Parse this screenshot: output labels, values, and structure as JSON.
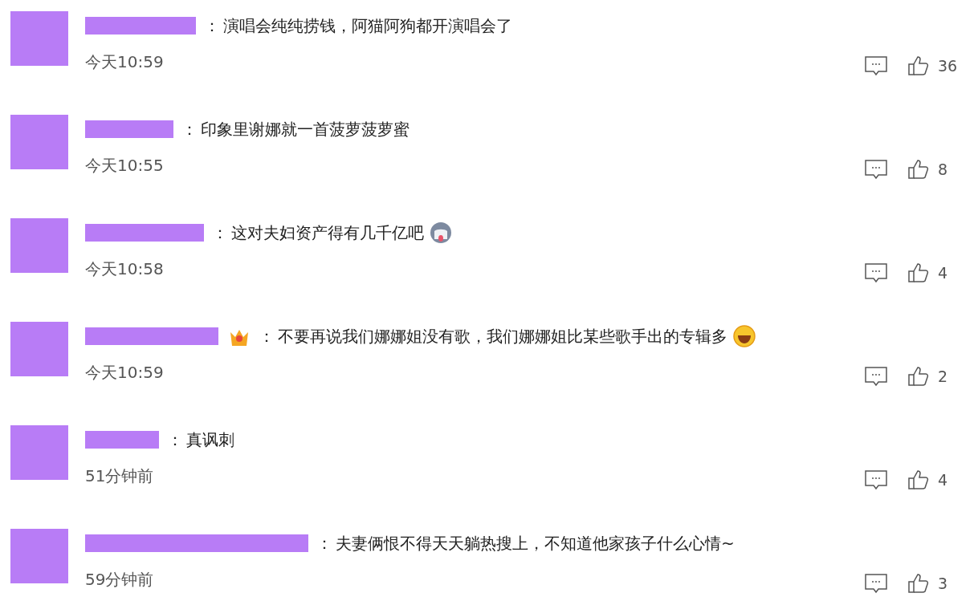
{
  "comments": [
    {
      "separator": "：",
      "text": "演唱会纯纯捞钱，阿猫阿狗都开演唱会了",
      "time": "今天10:59",
      "likes": "36"
    },
    {
      "separator": "：",
      "text": "印象里谢娜就一首菠萝菠萝蜜",
      "time": "今天10:55",
      "likes": "8"
    },
    {
      "separator": "：",
      "text": "这对夫妇资产得有几千亿吧",
      "time": "今天10:58",
      "likes": "4",
      "emoji": {
        "kind": "dog"
      }
    },
    {
      "separator": "：",
      "text": "不要再说我们娜娜姐没有歌，我们娜娜姐比某些歌手出的专辑多",
      "time": "今天10:59",
      "likes": "2",
      "badge": {
        "kind": "crown"
      },
      "emoji": {
        "kind": "laugh"
      }
    },
    {
      "separator": "：",
      "text": "真讽刺",
      "time": "51分钟前",
      "likes": "4"
    },
    {
      "separator": "：",
      "text": "夫妻俩恨不得天天躺热搜上，不知道他家孩子什么心情~",
      "time": "59分钟前",
      "likes": "3"
    }
  ]
}
